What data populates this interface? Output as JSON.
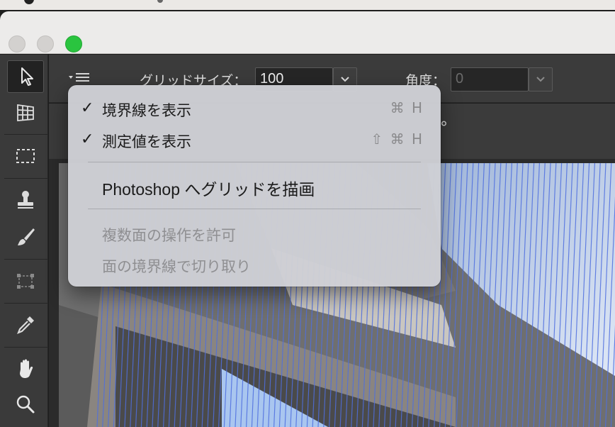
{
  "options_bar": {
    "grid_size_label": "グリッドサイズ：",
    "grid_size_value": "100",
    "angle_label": "角度：",
    "angle_value": "0",
    "menu_button_icon": "hamburger-menu-icon"
  },
  "substrip": {
    "degree_symbol": "°"
  },
  "toolbar": {
    "tools": [
      {
        "name": "move-tool",
        "icon": "arrow-cursor-icon",
        "active": true
      },
      {
        "name": "grid-tool",
        "icon": "perspective-grid-icon",
        "active": false
      },
      {
        "name": "marquee-tool",
        "icon": "dashed-rectangle-icon",
        "active": false
      },
      {
        "name": "stamp-tool",
        "icon": "stamp-icon",
        "active": false
      },
      {
        "name": "brush-tool",
        "icon": "brush-icon",
        "active": false
      },
      {
        "name": "transform-tool",
        "icon": "transform-box-icon",
        "active": false
      },
      {
        "name": "eyedropper-tool",
        "icon": "eyedropper-icon",
        "active": false
      },
      {
        "name": "hand-tool",
        "icon": "hand-icon",
        "active": false
      },
      {
        "name": "zoom-tool",
        "icon": "magnifier-icon",
        "active": false
      }
    ]
  },
  "menu": {
    "items": [
      {
        "label": "境界線を表示",
        "checked": true,
        "shortcut": "⌘ H",
        "enabled": true
      },
      {
        "label": "測定値を表示",
        "checked": true,
        "shortcut": "⇧ ⌘ H",
        "enabled": true
      },
      {
        "label": "Photoshop へグリッドを描画",
        "checked": false,
        "shortcut": "",
        "enabled": true
      },
      {
        "label": "複数面の操作を許可",
        "checked": false,
        "shortcut": "",
        "enabled": false
      },
      {
        "label": "面の境界線で切り取り",
        "checked": false,
        "shortcut": "",
        "enabled": false
      }
    ],
    "check_glyph": "✓"
  },
  "colors": {
    "accent_green": "#2ac43f",
    "grid_line": "#4f6fe0",
    "menu_bg": "#ced0d5"
  }
}
